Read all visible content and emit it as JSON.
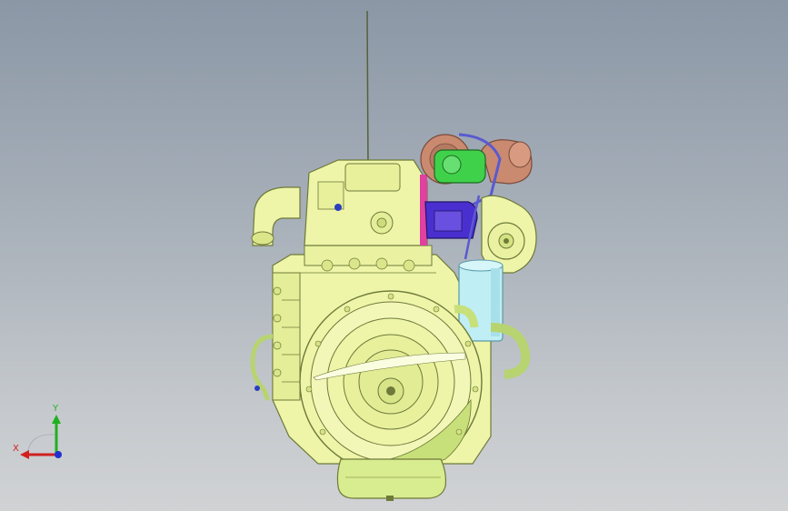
{
  "viewport": {
    "background_top": "#8b97a6",
    "background_bottom": "#d0d2d4"
  },
  "model": {
    "colors": {
      "body": "#eef5a8",
      "body_stroke": "#6e7a3a",
      "flywheel": "#f2f7b8",
      "flywheel_shade": "#c8e07a",
      "turbo_copper": "#c98a70",
      "turbo_green": "#3fd14a",
      "actuator_purple": "#4a2fd0",
      "filter_cyan": "#bfeef5",
      "pink": "#e040a0",
      "hose_blue": "#5a5ad0"
    }
  },
  "triad": {
    "x_label": "X",
    "y_label": "Y",
    "x_color": "#d02020",
    "y_color": "#20b020",
    "z_color": "#2030d0"
  }
}
